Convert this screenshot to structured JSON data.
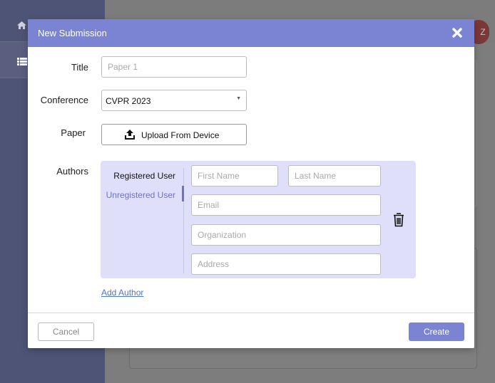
{
  "background": {
    "sidebar_icons": [
      "home-icon",
      "list-icon"
    ],
    "avatar_initial": "Z"
  },
  "modal": {
    "title": "New Submission",
    "close_icon": "close-icon",
    "accent_color": "#7b84d2"
  },
  "form": {
    "title_label": "Title",
    "title_placeholder": "Paper 1",
    "conference_label": "Conference",
    "conference_value": "CVPR 2023",
    "paper_label": "Paper",
    "upload_label": "Upload From Device",
    "upload_icon": "upload-icon",
    "authors_label": "Authors"
  },
  "authors": {
    "tabs": [
      {
        "label": "Registered User",
        "selected": false
      },
      {
        "label": "Unregistered User",
        "selected": true
      }
    ],
    "first_name_placeholder": "First Name",
    "last_name_placeholder": "Last Name",
    "email_placeholder": "Email",
    "organization_placeholder": "Organization",
    "address_placeholder": "Address",
    "delete_icon": "trash-icon",
    "add_author_label": "Add Author"
  },
  "footer": {
    "cancel_label": "Cancel",
    "create_label": "Create"
  }
}
